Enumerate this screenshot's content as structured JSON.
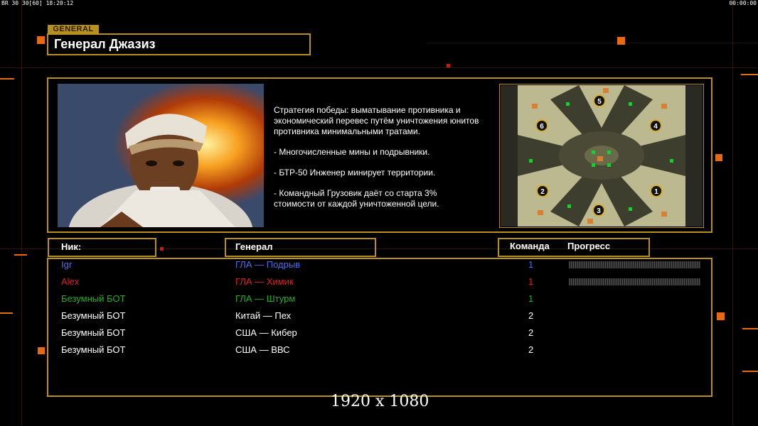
{
  "hud": {
    "left": "BR 30 30[60] 18:20:12",
    "right": "00:00:00"
  },
  "header": {
    "tag": "GENERAL",
    "title": "Генерал Джазиз"
  },
  "description": {
    "lines": [
      "Стратегия победы: выматывание противника и\n экономический перевес путём уничтожения юнитов\n противника минимальными тратами.",
      "- Многочисленные мины и подрывники.",
      "- БТР-50 Инженер минирует территории.",
      "- Командный Грузовик даёт со старта 3%\n стоимости от каждой уничтоженной цели."
    ]
  },
  "map": {
    "slots": [
      "1",
      "2",
      "3",
      "4",
      "5",
      "6"
    ]
  },
  "table": {
    "headers": {
      "nick": "Ник:",
      "general": "Генерал",
      "team": "Команда",
      "progress": "Прогресс"
    },
    "rows": [
      {
        "nick": "Igr",
        "general": "ГЛА — Подрыв",
        "team": "1",
        "color": "#4a70e8",
        "progress": 0
      },
      {
        "nick": "Alex",
        "general": "ГЛА — Химик",
        "team": "1",
        "color": "#e02020",
        "progress": 0
      },
      {
        "nick": "Безумный БОТ",
        "general": "ГЛА — Штурм",
        "team": "1",
        "color": "#22b022"
      },
      {
        "nick": "Безумный БОТ",
        "general": "Китай — Пех",
        "team": "2",
        "color": "#ffffff"
      },
      {
        "nick": "Безумный БОТ",
        "general": "США — Кибер",
        "team": "2",
        "color": "#ffffff"
      },
      {
        "nick": "Безумный БОТ",
        "general": "США — ВВС",
        "team": "2",
        "color": "#ffffff"
      }
    ]
  },
  "resolution": "1920 x 1080",
  "colors": {
    "accent": "#b8901c",
    "deco": "#e86a10"
  }
}
